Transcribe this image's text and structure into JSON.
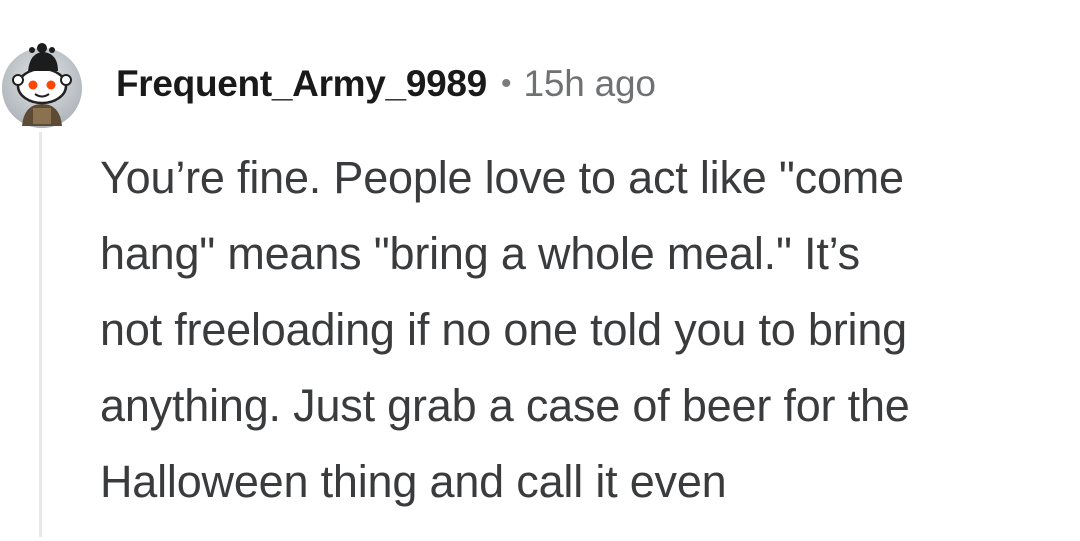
{
  "comment": {
    "author": "Frequent_Army_9989",
    "separator": "•",
    "time_ago": "15h ago",
    "avatar_icon": "snoo-avatar-icon",
    "body_lines": [
      "You’re fine. People love to act like \"come",
      "hang\" means \"bring a whole meal.\" It’s",
      "not freeloading if no one told you to bring",
      "anything. Just grab a case of beer for the",
      "Halloween thing and call it even"
    ]
  }
}
